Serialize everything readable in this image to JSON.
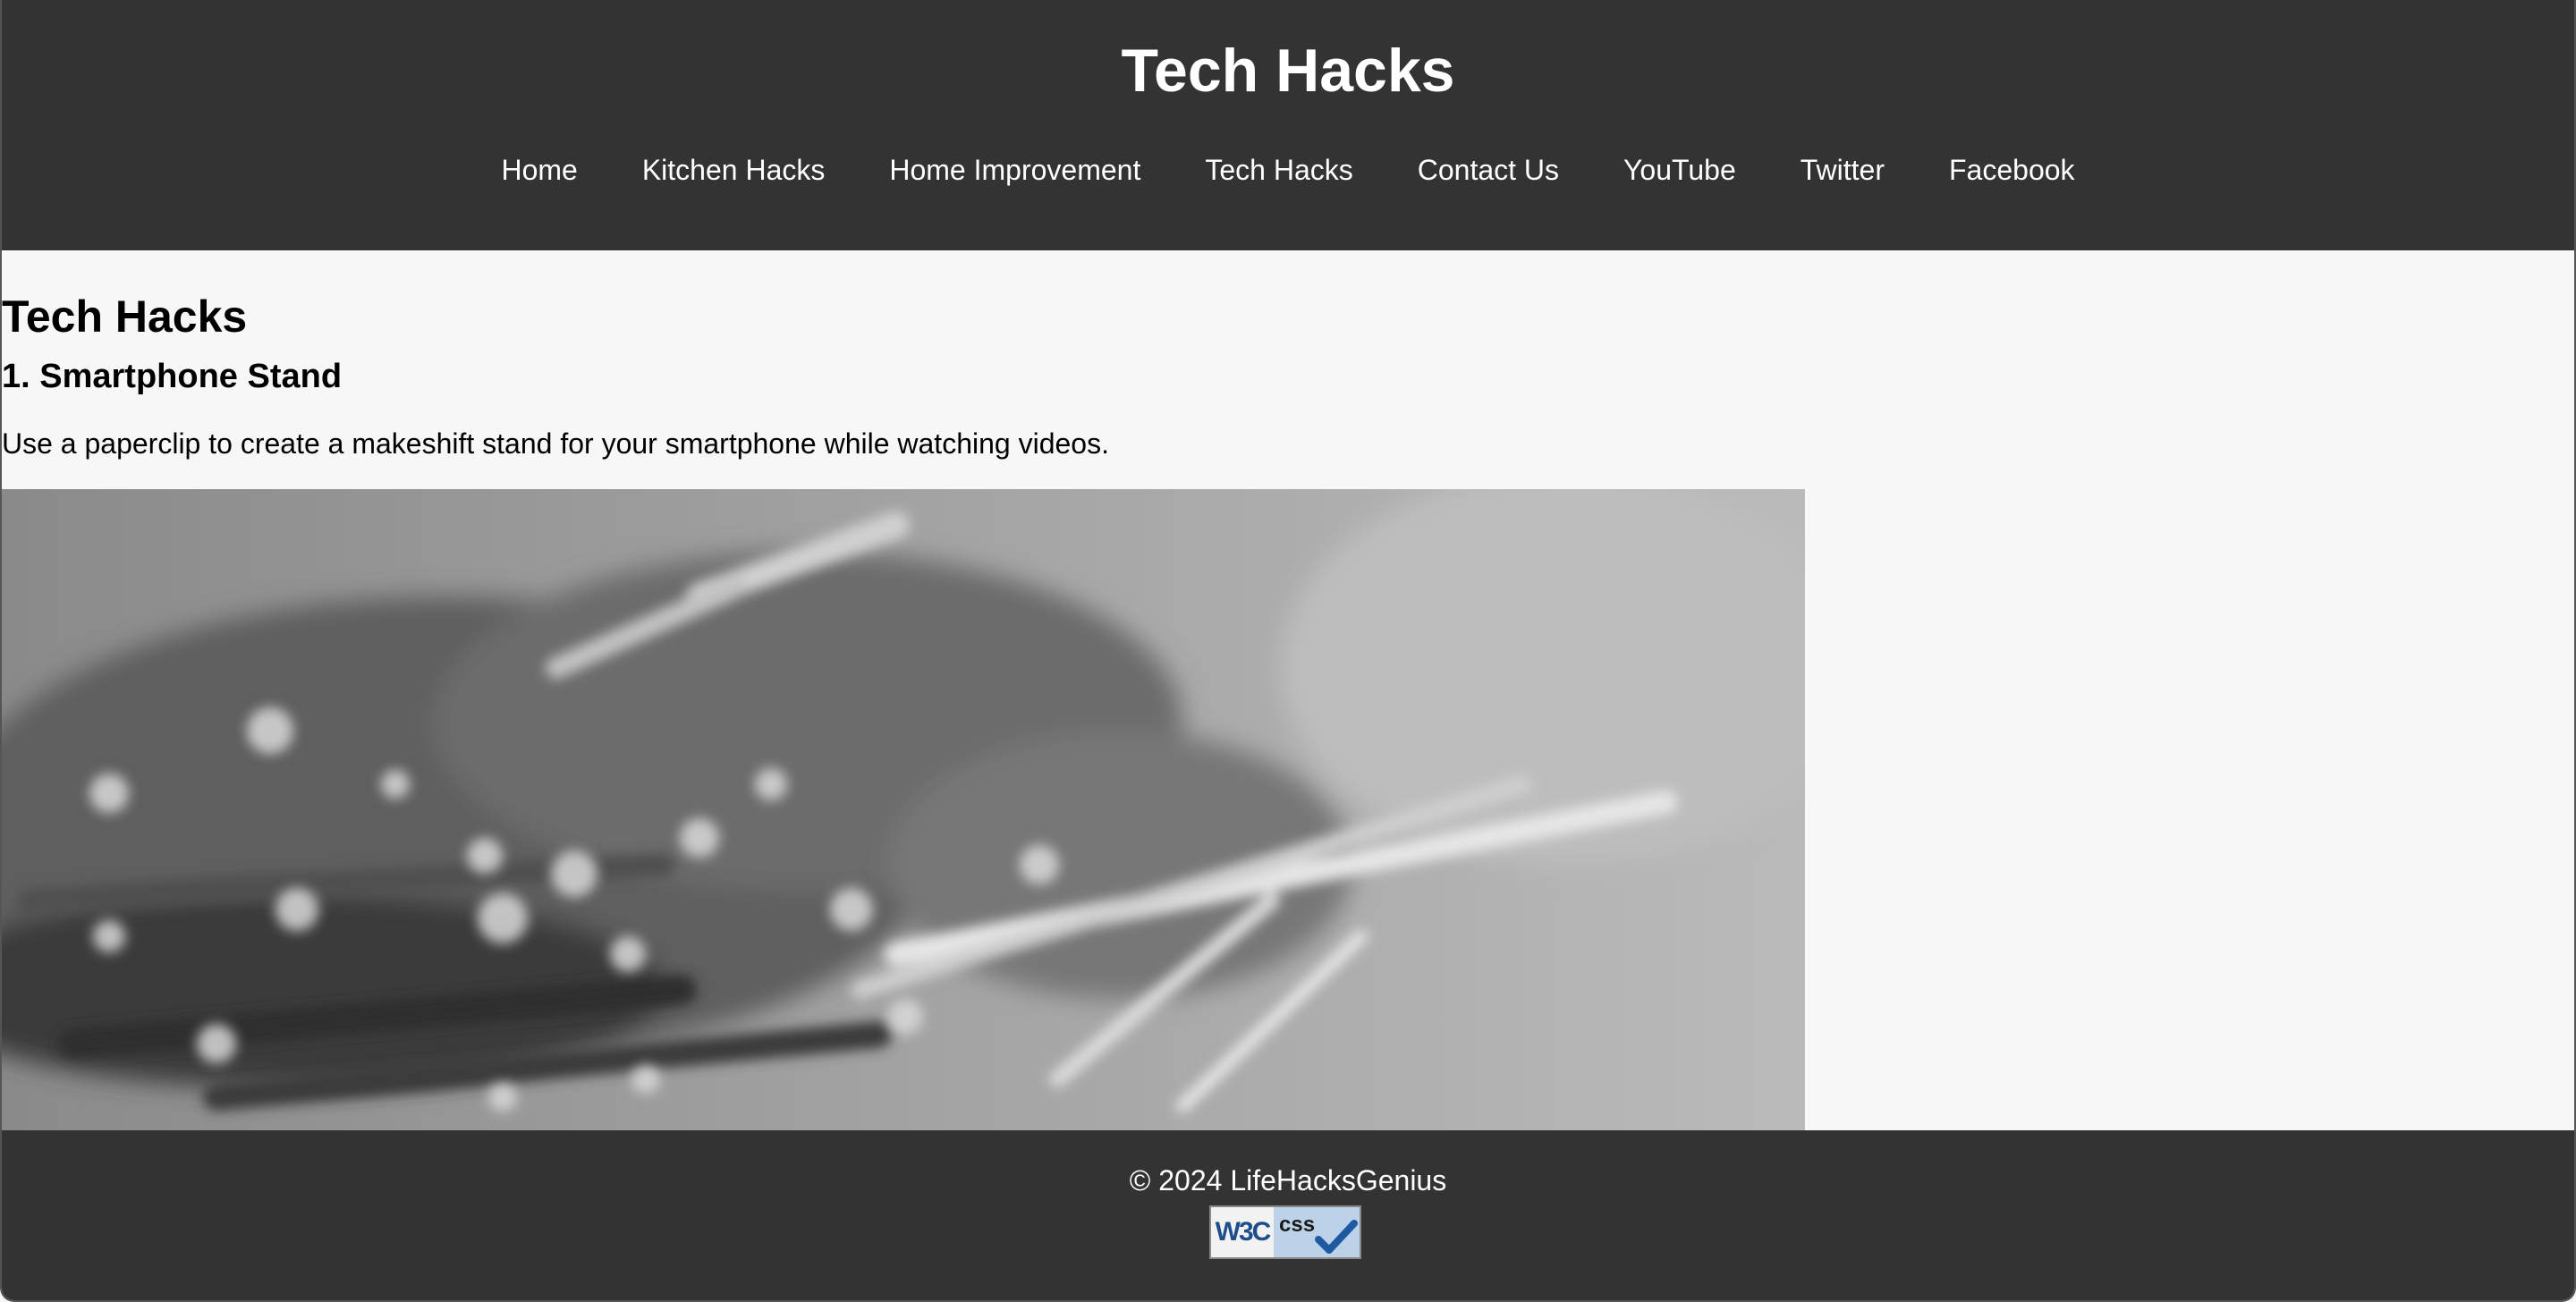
{
  "site": {
    "title": "Tech Hacks"
  },
  "nav": {
    "items": [
      {
        "label": "Home"
      },
      {
        "label": "Kitchen Hacks"
      },
      {
        "label": "Home Improvement"
      },
      {
        "label": "Tech Hacks"
      },
      {
        "label": "Contact Us"
      },
      {
        "label": "YouTube"
      },
      {
        "label": "Twitter"
      },
      {
        "label": "Facebook"
      }
    ]
  },
  "main": {
    "page_title": "Tech Hacks",
    "hacks": [
      {
        "title": "1. Smartphone Stand",
        "description": "Use a paperclip to create a makeshift stand for your smartphone while watching videos."
      }
    ]
  },
  "footer": {
    "copyright": "© 2024 LifeHacksGenius",
    "badge_w3c": "W3C",
    "badge_css": "css"
  },
  "colors": {
    "header_bg": "#333333",
    "page_bg": "#f7f7f7",
    "text": "#000000",
    "header_text": "#ffffff"
  }
}
